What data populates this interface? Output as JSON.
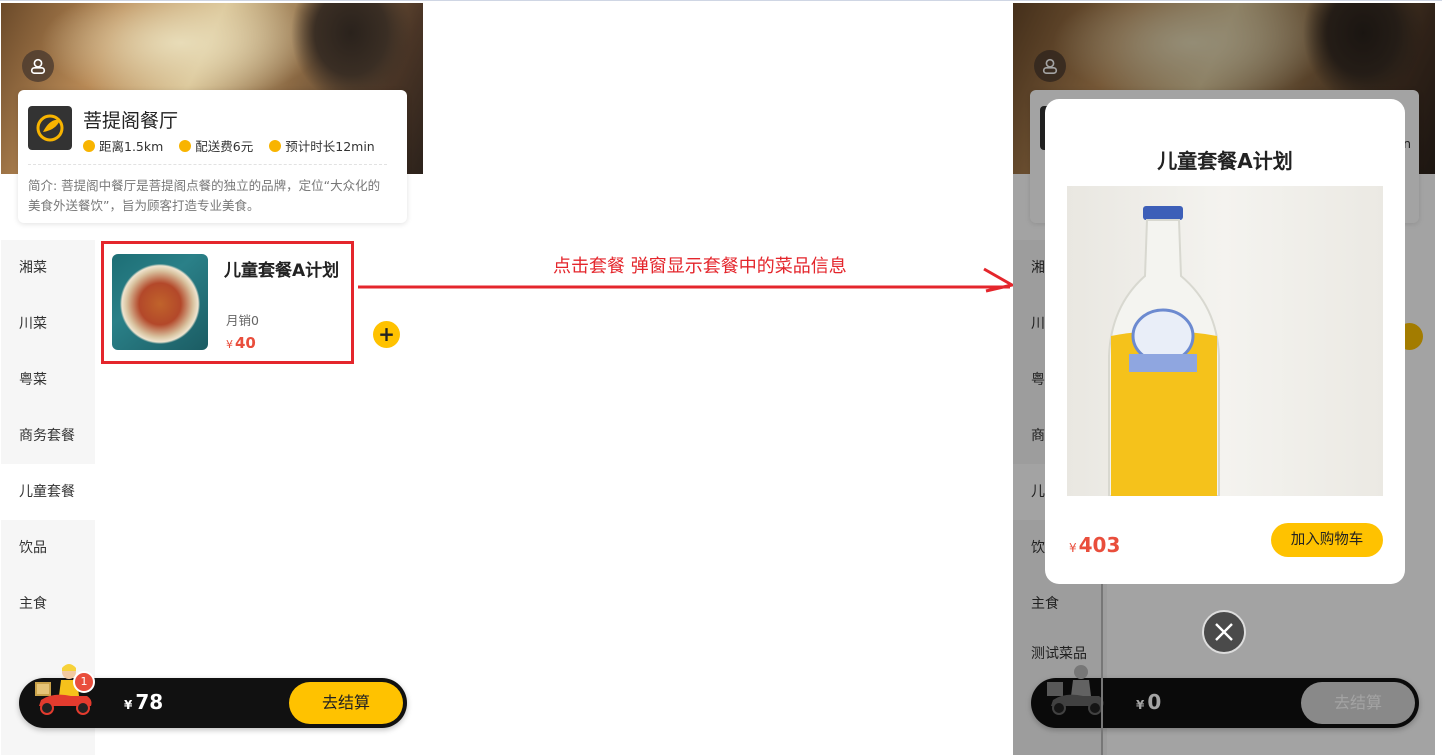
{
  "left_phone": {
    "shop": {
      "name": "菩提阁餐厅",
      "distance": "距离1.5km",
      "delivery_fee": "配送费6元",
      "eta": "预计时长12min",
      "intro": "简介: 菩提阁中餐厅是菩提阁点餐的独立的品牌，定位“大众化的美食外送餐饮”，旨为顾客打造专业美食。"
    },
    "categories": [
      {
        "label": "湘菜"
      },
      {
        "label": "川菜"
      },
      {
        "label": "粤菜"
      },
      {
        "label": "商务套餐"
      },
      {
        "label": "儿童套餐"
      },
      {
        "label": "饮品"
      },
      {
        "label": "主食"
      }
    ],
    "active_category": "儿童套餐",
    "dish": {
      "title": "儿童套餐A计划",
      "sales": "月销0",
      "currency": "¥",
      "price": "40",
      "add_symbol": "+"
    },
    "cart": {
      "badge": "1",
      "currency": "¥",
      "total": "78",
      "checkout_label": "去结算"
    }
  },
  "annotation": {
    "text": "点击套餐 弹窗显示套餐中的菜品信息",
    "color": "#e4262c"
  },
  "right_phone": {
    "categories": [
      {
        "label": "湘"
      },
      {
        "label": "川"
      },
      {
        "label": "粤"
      },
      {
        "label": "商"
      },
      {
        "label": "儿"
      },
      {
        "label": "饮"
      },
      {
        "label": "主食"
      },
      {
        "label": "测试菜品"
      }
    ],
    "modal": {
      "title": "儿童套餐A计划",
      "currency": "¥",
      "price": "403",
      "add_to_cart_label": "加入购物车"
    },
    "shop_eta_fragment": "n",
    "cart": {
      "currency": "¥",
      "total": "0",
      "checkout_label": "去结算"
    }
  },
  "colors": {
    "accent": "#ffc200",
    "price": "#e94e3c",
    "cart_bar": "#111111"
  }
}
